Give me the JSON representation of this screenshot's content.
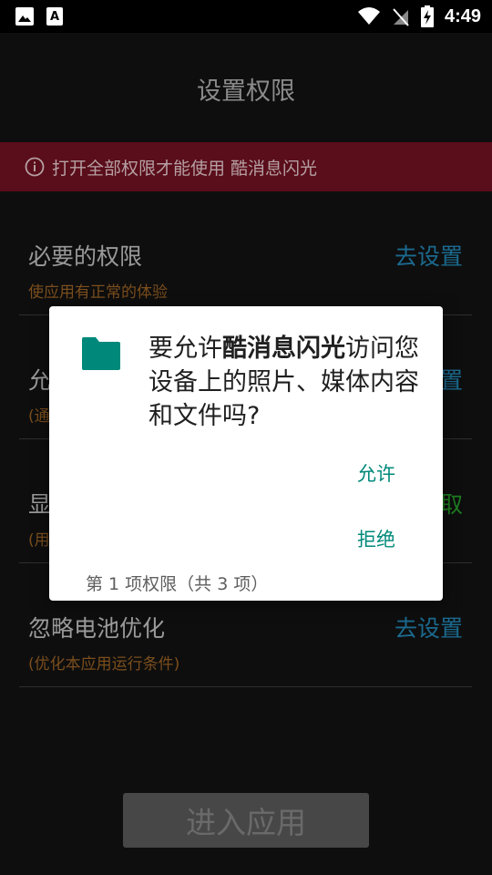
{
  "status_bar": {
    "time": "4:49",
    "icons": [
      "image-icon",
      "text-a-icon",
      "wifi-icon",
      "no-signal-icon",
      "battery-charging-icon"
    ]
  },
  "screen": {
    "title": "设置权限",
    "warning": "打开全部权限才能使用 酷消息闪光",
    "enter_button": "进入应用"
  },
  "permission_rows": [
    {
      "title": "必要的权限",
      "subtitle": "使应用有正常的体验",
      "action": "去设置"
    },
    {
      "title": "允",
      "subtitle": "(通",
      "action": "置"
    },
    {
      "title": "显",
      "subtitle": "(用",
      "action": "取"
    },
    {
      "title": "忽略电池优化",
      "subtitle": "(优化本应用运行条件)",
      "action": "去设置"
    }
  ],
  "dialog": {
    "msg_prefix": "要允许",
    "app_name": "酷消息闪光",
    "msg_suffix": "访问您设备上的照片、媒体内容和文件吗?",
    "allow": "允许",
    "deny": "拒绝",
    "count": "第 1 项权限（共 3 项）"
  },
  "colors": {
    "accent_teal": "#00897b",
    "warning_bg": "#5a0d1a",
    "link_blue": "#1b6a8f",
    "link_green": "#1d7d20",
    "orange_sub": "#7b4e1d"
  }
}
